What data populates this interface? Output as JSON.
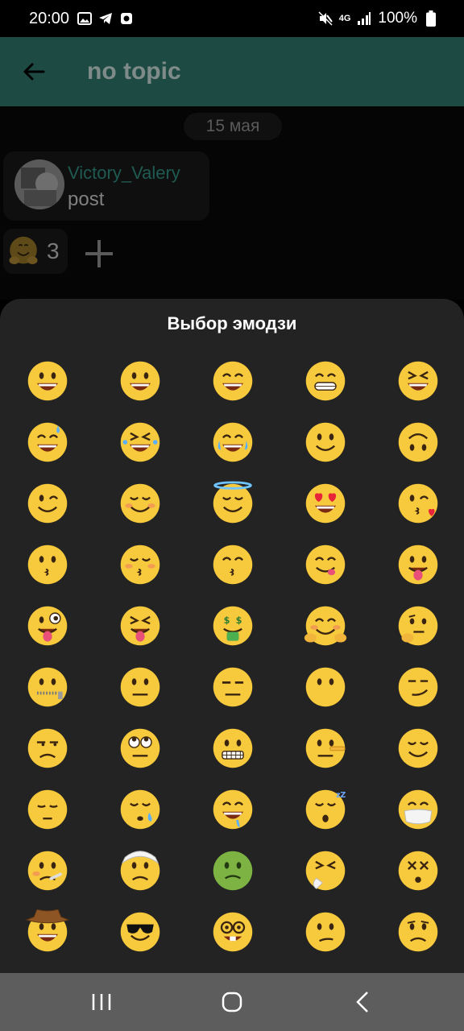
{
  "status_bar": {
    "time": "20:00",
    "network": "4G",
    "battery": "100%"
  },
  "app_bar": {
    "title": "no topic"
  },
  "chat": {
    "date": "15 мая",
    "message": {
      "author": "Victory_Valery",
      "text": "post"
    },
    "reaction": {
      "emoji": "hugging",
      "count": "3"
    }
  },
  "picker": {
    "title": "Выбор эмодзи",
    "emojis": [
      "grinning",
      "smiley",
      "smile",
      "grin",
      "laughing",
      "sweat-smile",
      "rofl",
      "joy",
      "slightly-smiling",
      "upside-down",
      "wink",
      "blush",
      "innocent",
      "heart-eyes",
      "kissing-heart",
      "kissing",
      "kissing-closed-eyes",
      "kissing-smiling-eyes",
      "yum",
      "stuck-out-tongue",
      "zany",
      "squinting-tongue",
      "money-mouth",
      "hugging",
      "thinking",
      "zipper-mouth",
      "neutral",
      "expressionless",
      "no-mouth",
      "smirk",
      "unamused",
      "rolling-eyes",
      "grimacing",
      "lying",
      "relieved",
      "pensive",
      "sleepy",
      "drooling",
      "sleeping",
      "mask",
      "thermometer",
      "head-bandage",
      "nauseated",
      "sneezing",
      "dizzy",
      "cowboy",
      "sunglasses",
      "nerd",
      "confused",
      "worried",
      "row-partial",
      "row-partial",
      "row-partial",
      "row-partial",
      "row-partial"
    ]
  },
  "colors": {
    "sheet": "#232323",
    "appbar": "#1d4a42",
    "emoji_yellow": "#f7c93c",
    "nav": "#5d5d5d"
  }
}
